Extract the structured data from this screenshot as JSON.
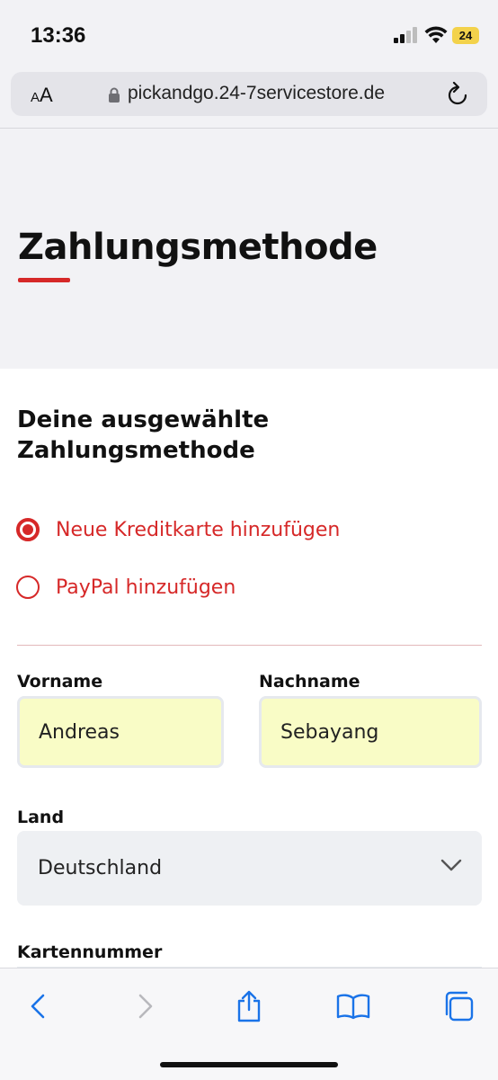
{
  "status_bar": {
    "time": "13:36",
    "battery": "24"
  },
  "browser": {
    "text_size_small": "A",
    "text_size_large": "A",
    "url": "pickandgo.24-7servicestore.de"
  },
  "page": {
    "title": "Zahlungsmethode"
  },
  "payment": {
    "section_title": "Deine ausgewählte Zahlungsmethode",
    "options": [
      {
        "label": "Neue Kreditkarte hinzufügen",
        "selected": true
      },
      {
        "label": "PayPal hinzufügen",
        "selected": false
      }
    ]
  },
  "form": {
    "first_name": {
      "label": "Vorname",
      "value": "Andreas"
    },
    "last_name": {
      "label": "Nachname",
      "value": "Sebayang"
    },
    "country": {
      "label": "Land",
      "value": "Deutschland"
    },
    "card_number": {
      "label": "Kartennummer"
    }
  },
  "colors": {
    "accent": "#d62828",
    "autofill": "#f9fcc6",
    "background": "#f2f2f5"
  },
  "icons": {
    "toolbar": [
      "back-icon",
      "forward-icon",
      "share-icon",
      "bookmarks-icon",
      "tabs-icon"
    ],
    "address_bar": [
      "lock-icon",
      "reload-icon"
    ]
  }
}
